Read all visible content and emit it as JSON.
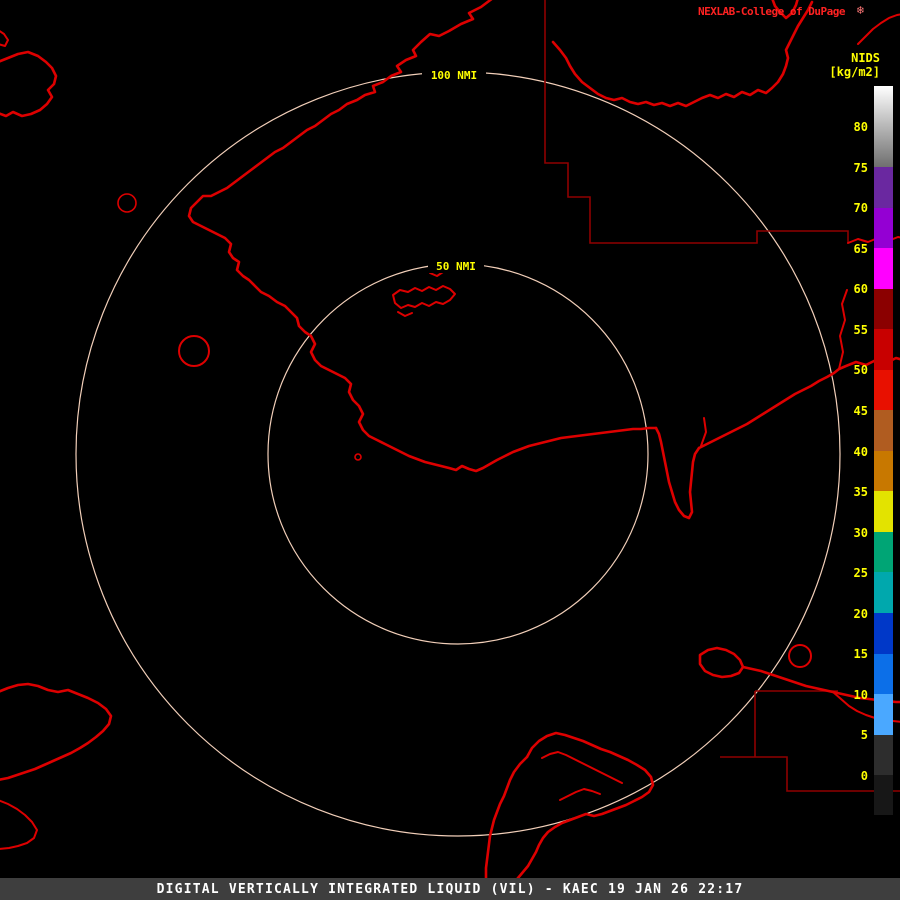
{
  "header": {
    "brand": "NEXLAB-College of DuPage",
    "icon": "❄"
  },
  "colorbar": {
    "title": "NIDS",
    "units": "[kg/m2]",
    "ticks": [
      "0",
      "5",
      "10",
      "15",
      "20",
      "25",
      "30",
      "35",
      "40",
      "45",
      "50",
      "55",
      "60",
      "65",
      "70",
      "75",
      "80"
    ],
    "tick_unit": "kg/m2",
    "segments": [
      {
        "range": "75-85",
        "gradient": [
          "#ffffff",
          "#6f6f6f"
        ],
        "height": 81
      },
      {
        "range": "70-75",
        "color": "#6a28a0",
        "height": 40.56
      },
      {
        "range": "65-70",
        "color": "#9400d3",
        "height": 40.56
      },
      {
        "range": "60-65",
        "color": "#ff00ff",
        "height": 40.56
      },
      {
        "range": "55-60",
        "color": "#8b0000",
        "height": 40.56
      },
      {
        "range": "50-55",
        "color": "#c80000",
        "height": 40.56
      },
      {
        "range": "45-50",
        "color": "#e81000",
        "height": 40.56
      },
      {
        "range": "40-45",
        "color": "#b05c20",
        "height": 40.56
      },
      {
        "range": "35-40",
        "color": "#c87800",
        "height": 40.56
      },
      {
        "range": "30-35",
        "color": "#e3e300",
        "height": 40.56
      },
      {
        "range": "25-30",
        "color": "#00a575",
        "height": 40.56
      },
      {
        "range": "20-25",
        "color": "#00a8ad",
        "height": 40.56
      },
      {
        "range": "15-20",
        "color": "#0038c8",
        "height": 40.56
      },
      {
        "range": "10-15",
        "color": "#0c6fe8",
        "height": 40.56
      },
      {
        "range": "5-10",
        "color": "#4aa8ff",
        "height": 40.56
      },
      {
        "range": "0-5",
        "color": "#2d2d2d",
        "height": 40.56
      },
      {
        "range": "below-0",
        "color": "#171717",
        "height": 40
      }
    ]
  },
  "map": {
    "rings": [
      {
        "label": "100 NMI"
      },
      {
        "label": "50 NMI"
      }
    ]
  },
  "footer": {
    "text": "DIGITAL VERTICALLY INTEGRATED LIQUID (VIL) - KAEC 19 JAN 26 22:17"
  },
  "colors": {
    "background": "#000000",
    "coastline": "#dd0000",
    "boundary": "#8f0000",
    "range_ring": "#f2cfb9",
    "label_yellow": "#ffff00",
    "brand_red": "#ff2222",
    "footer_bg": "#3e3e3e",
    "footer_text": "#ffffff"
  }
}
